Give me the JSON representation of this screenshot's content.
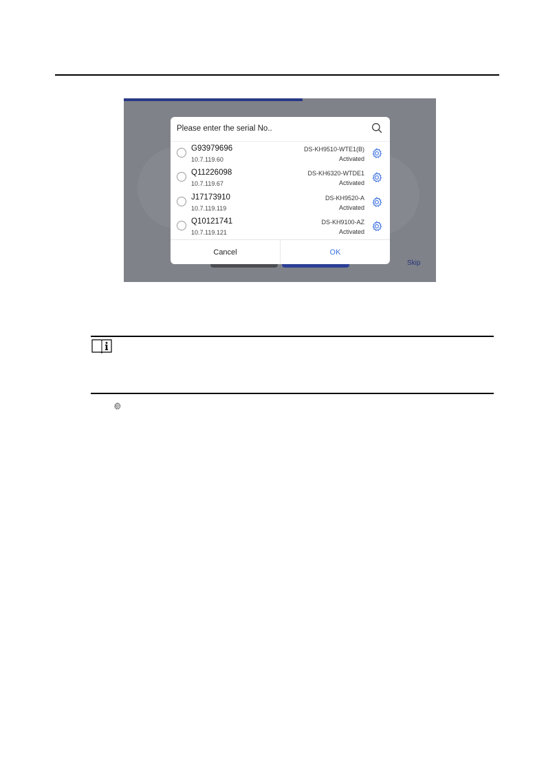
{
  "screenshot": {
    "skip_label": "Skip",
    "dialog": {
      "search_placeholder": "Please enter the serial No..",
      "devices": [
        {
          "serial": "G93979696",
          "ip": "10.7.119.60",
          "model": "DS-KH9510-WTE1(B)",
          "status": "Activated"
        },
        {
          "serial": "Q11226098",
          "ip": "10.7.119.67",
          "model": "DS-KH6320-WTDE1",
          "status": "Activated"
        },
        {
          "serial": "J17173910",
          "ip": "10.7.119.119",
          "model": "DS-KH9520-A",
          "status": "Activated"
        },
        {
          "serial": "Q10121741",
          "ip": "10.7.119.121",
          "model": "DS-KH9100-AZ",
          "status": "Activated"
        }
      ],
      "cancel_label": "Cancel",
      "ok_label": "OK"
    }
  },
  "icons": {
    "search": "search-icon",
    "settings": "gear-icon",
    "note": "note-book-info-icon"
  },
  "colors": {
    "accent_blue": "#3b6fe0",
    "progress_bar": "#283a86",
    "overlay_gray": "#7f8289"
  }
}
